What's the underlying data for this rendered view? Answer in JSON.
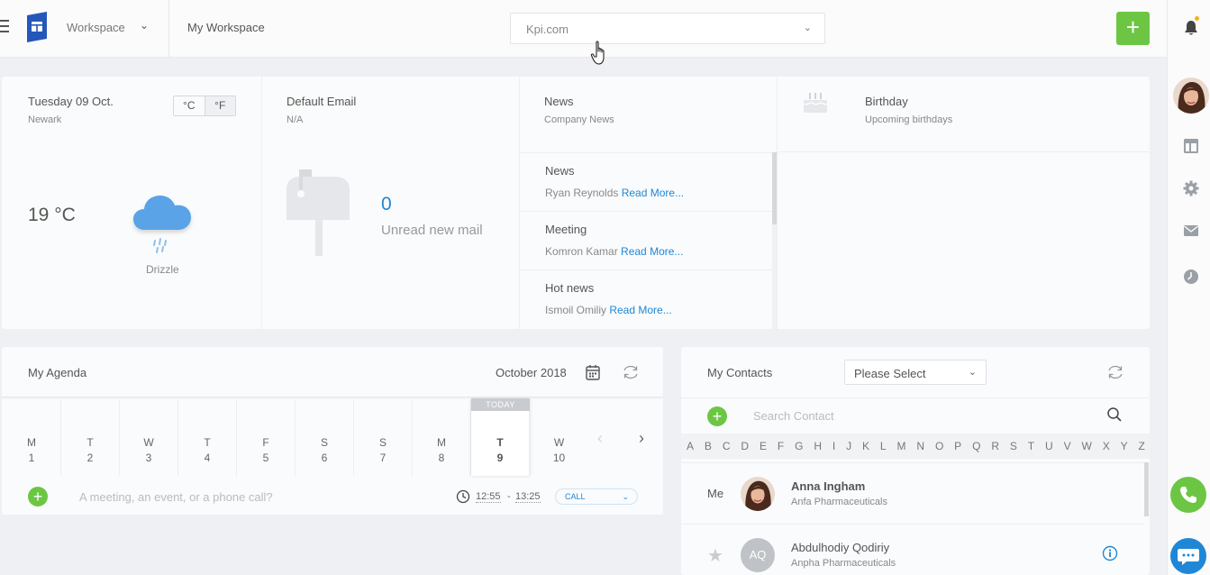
{
  "header": {
    "workspace_label": "Workspace",
    "breadcrumb": "My Workspace",
    "domain_value": "Kpi.com",
    "add_label": "+"
  },
  "weather": {
    "date": "Tuesday 09 Oct.",
    "city": "Newark",
    "unit_c": "°C",
    "unit_f": "°F",
    "temperature": "19 °C",
    "condition": "Drizzle"
  },
  "email": {
    "title": "Default Email",
    "subtitle": "N/A",
    "unread_count": "0",
    "unread_label": "Unread new mail"
  },
  "news": {
    "title": "News",
    "subtitle": "Company News",
    "read_more": "Read More...",
    "items": [
      {
        "title": "News",
        "author": "Ryan Reynolds"
      },
      {
        "title": "Meeting",
        "author": "Komron Kamar"
      },
      {
        "title": "Hot news",
        "author": "Ismoil Omiliy"
      }
    ]
  },
  "birthday": {
    "title": "Birthday",
    "subtitle": "Upcoming birthdays"
  },
  "agenda": {
    "title": "My Agenda",
    "month": "October 2018",
    "today_label": "TODAY",
    "days": [
      {
        "letter": "M",
        "num": "1"
      },
      {
        "letter": "T",
        "num": "2"
      },
      {
        "letter": "W",
        "num": "3"
      },
      {
        "letter": "T",
        "num": "4"
      },
      {
        "letter": "F",
        "num": "5"
      },
      {
        "letter": "S",
        "num": "6"
      },
      {
        "letter": "S",
        "num": "7"
      },
      {
        "letter": "M",
        "num": "8"
      },
      {
        "letter": "T",
        "num": "9"
      },
      {
        "letter": "W",
        "num": "10"
      }
    ],
    "placeholder": "A meeting, an event, or a phone call?",
    "time_start": "12:55",
    "time_sep": "-",
    "time_end": "13:25",
    "type": "CALL"
  },
  "contacts": {
    "title": "My Contacts",
    "select_value": "Please Select",
    "search_placeholder": "Search Contact",
    "alphabet": [
      "A",
      "B",
      "C",
      "D",
      "E",
      "F",
      "G",
      "H",
      "I",
      "J",
      "K",
      "L",
      "M",
      "N",
      "O",
      "P",
      "Q",
      "R",
      "S",
      "T",
      "U",
      "V",
      "W",
      "X",
      "Y",
      "Z"
    ],
    "me_label": "Me",
    "rows": [
      {
        "name": "Anna Ingham",
        "company": "Anfa Pharmaceuticals"
      },
      {
        "initials": "AQ",
        "name": "Abdulhodiy Qodiriy",
        "company": "Anpha Pharmaceuticals"
      }
    ]
  },
  "colors": {
    "accent_green": "#6cc644",
    "accent_blue": "#1f87d6",
    "brand_blue": "#2557b9",
    "notification_dot": "#f6b019"
  }
}
